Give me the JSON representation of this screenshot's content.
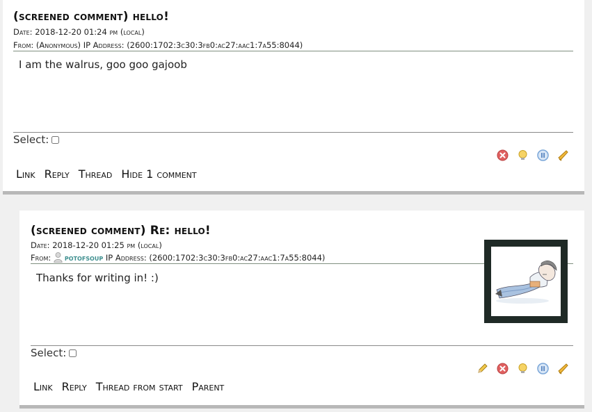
{
  "comments": [
    {
      "subject": "(screened comment) hello!",
      "date_label": "Date:",
      "date_value": "2018-12-20 01:24 pm (local)",
      "from_label": "From:",
      "from_value": "(Anonymous)",
      "ip_label": "IP Address:",
      "ip_value": "(2600:1702:3c30:3fb0:ac27:aac1:7a55:8044)",
      "body": "I am the walrus, goo goo gajoob",
      "select_label": "Select:",
      "links": [
        "Link",
        "Reply",
        "Thread",
        "Hide 1 comment"
      ]
    },
    {
      "subject": "(screened comment) Re: hello!",
      "date_label": "Date:",
      "date_value": "2018-12-20 01:25 pm (local)",
      "from_label": "From:",
      "from_user": "potofsoup",
      "ip_label": "IP Address:",
      "ip_value": "(2600:1702:3c30:3fb0:ac27:aac1:7a55:8044)",
      "body": "Thanks for writing in! :)",
      "select_label": "Select:",
      "links": [
        "Link",
        "Reply",
        "Thread from start",
        "Parent"
      ]
    }
  ],
  "icons": {
    "delete": "delete-icon",
    "unscreen": "lightbulb-icon",
    "freeze": "pause-icon",
    "track": "bell-icon",
    "edit": "pencil-icon",
    "user": "user-icon"
  },
  "colors": {
    "accent_link": "#3d8f8f",
    "delete": "#e06060",
    "freeze": "#7aa6d8",
    "bulb": "#f2c94c"
  }
}
